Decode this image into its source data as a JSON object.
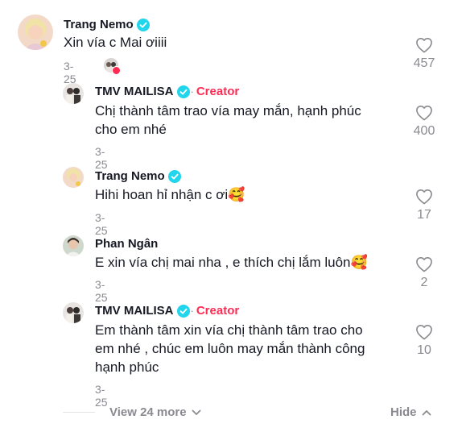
{
  "comments": [
    {
      "username": "Trang Nemo",
      "text": "Xin vía c Mai ơiiii",
      "date": "3-25",
      "likes": "457",
      "creator": "",
      "creator_dot": ""
    },
    {
      "username": "TMV MAILISA",
      "creator_dot": "·",
      "creator": "Creator",
      "text_lines": [
        "Chị thành tâm trao vía may mắn, hạnh phúc",
        "cho em nhé"
      ],
      "date": "3-25",
      "likes": "400"
    },
    {
      "username": "Trang Nemo",
      "text": "Hihi hoan hỉ nhận c ơi🥰",
      "date": "3-25",
      "likes": "17"
    },
    {
      "username": "Phan Ngân",
      "text": "E xin vía chị mai nha , e thích chị lắm luôn🥰",
      "date": "3-25",
      "likes": "2"
    },
    {
      "username": "TMV MAILISA",
      "creator_dot": "·",
      "creator": "Creator",
      "text_lines": [
        "Em thành tâm xin vía chị thành tâm trao cho",
        "em nhé , chúc em luôn may mắn thành công",
        "hạnh phúc"
      ],
      "date": "3-25",
      "likes": "10"
    }
  ],
  "footer": {
    "view_more": "View 24 more",
    "hide": "Hide"
  },
  "icons": {
    "verified": "verified-badge-icon",
    "heart": "heart-outline-icon",
    "chevron_down": "chevron-down-icon",
    "chevron_up": "chevron-up-icon"
  },
  "colors": {
    "verified": "#20d5ec",
    "creator": "#fe2c55",
    "muted": "#8a8b91",
    "text": "#161823"
  }
}
